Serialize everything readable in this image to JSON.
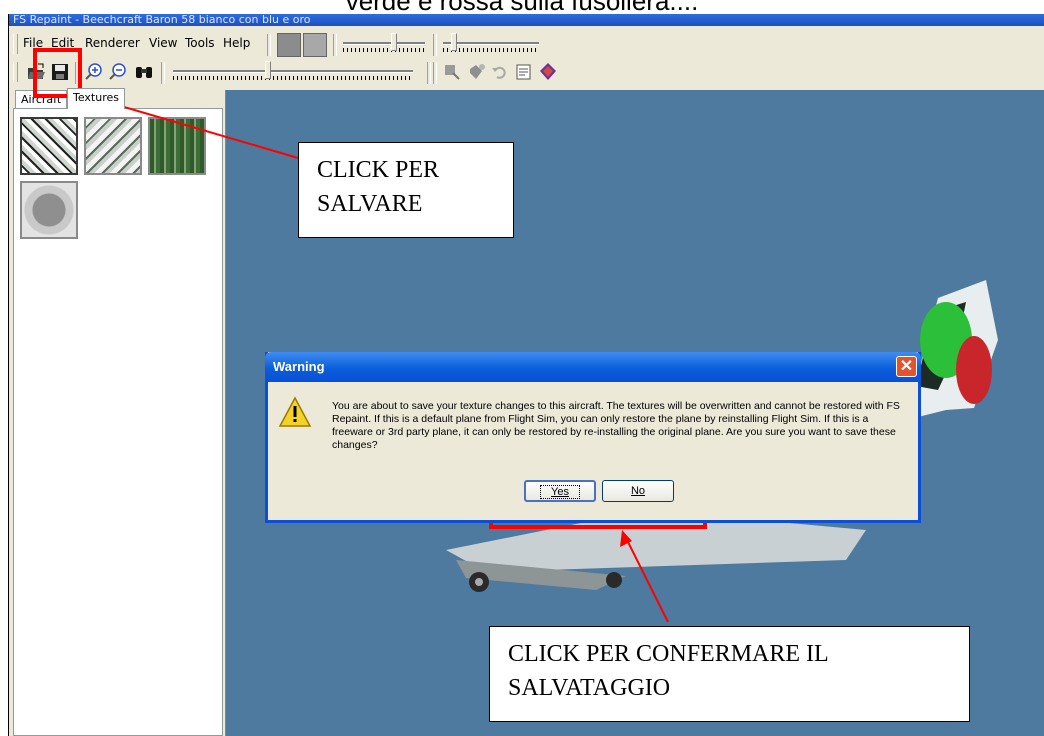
{
  "caption": "verde e rossa sulla fusoliera....",
  "window": {
    "title": "FS Repaint - Beechcraft Baron 58 bianco con blu e oro"
  },
  "menu": [
    "File",
    "Edit",
    "Renderer",
    "View",
    "Tools",
    "Help"
  ],
  "tabs": [
    {
      "label": "Aircraft"
    },
    {
      "label": "Textures"
    }
  ],
  "texture_thumbnails": [
    "texture-1",
    "texture-2",
    "texture-3",
    "texture-4"
  ],
  "icons": {
    "open": "folder-open-icon",
    "save": "floppy-disk-icon",
    "zoom_in": "zoom-in-icon",
    "zoom_out": "zoom-out-icon",
    "find": "binoculars-icon",
    "warning": "warning-triangle-icon",
    "close": "close-icon"
  },
  "dialog": {
    "title": "Warning",
    "message": "You are about to save your texture changes to this aircraft. The textures will be overwritten and cannot be restored with FS Repaint. If this is a default plane from Flight Sim, you can only restore the plane by reinstalling Flight Sim. If this is a freeware or 3rd party plane, it can only be restored by re-installing the original plane. Are you sure you want to save these changes?",
    "yes_label": "Yes",
    "no_label": "No"
  },
  "callouts": {
    "save": {
      "line1": "CLICK PER",
      "line2": "SALVARE"
    },
    "confirm": {
      "line1": "CLICK PER CONFERMARE IL",
      "line2": "SALVATAGGIO"
    }
  },
  "colors": {
    "viewport_bg": "#4d7a9e",
    "annotation_red": "#ff0000",
    "xp_title_blue": "#0a5ed9",
    "window_bg": "#ece9d8"
  }
}
